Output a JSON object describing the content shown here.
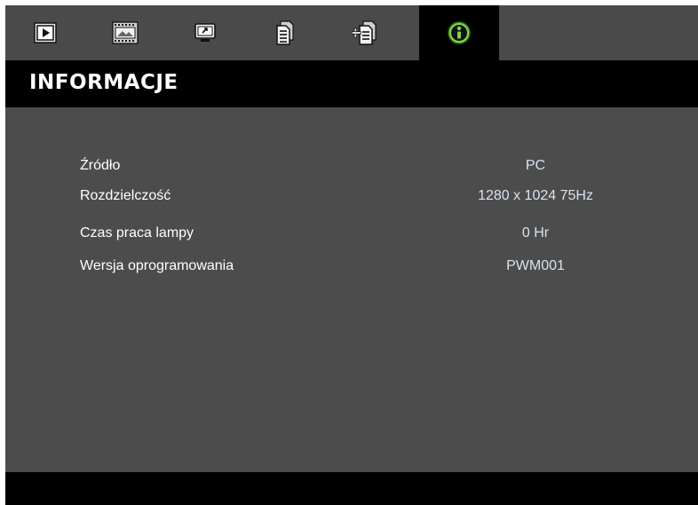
{
  "tabs": [
    {
      "icon": "play-screen-icon",
      "active": false
    },
    {
      "icon": "film-image-icon",
      "active": false
    },
    {
      "icon": "display-settings-icon",
      "active": false
    },
    {
      "icon": "document-icon",
      "active": false
    },
    {
      "icon": "document-add-icon",
      "active": false
    },
    {
      "icon": "info-icon",
      "active": true
    }
  ],
  "page": {
    "title": "INFORMACJE"
  },
  "info_rows": [
    {
      "label": "Źródło",
      "value": "PC"
    },
    {
      "label": "Rozdzielczość",
      "value": "1280 x 1024 75Hz"
    },
    {
      "label": "Czas praca lampy",
      "value": "0 Hr"
    },
    {
      "label": "Wersja oprogramowania",
      "value": "PWM001"
    }
  ],
  "colors": {
    "tab_bar": "#4a4a4a",
    "content_bg": "#4c4c4c",
    "active_icon": "#7cd84a",
    "value_text": "#d8e2ee"
  }
}
